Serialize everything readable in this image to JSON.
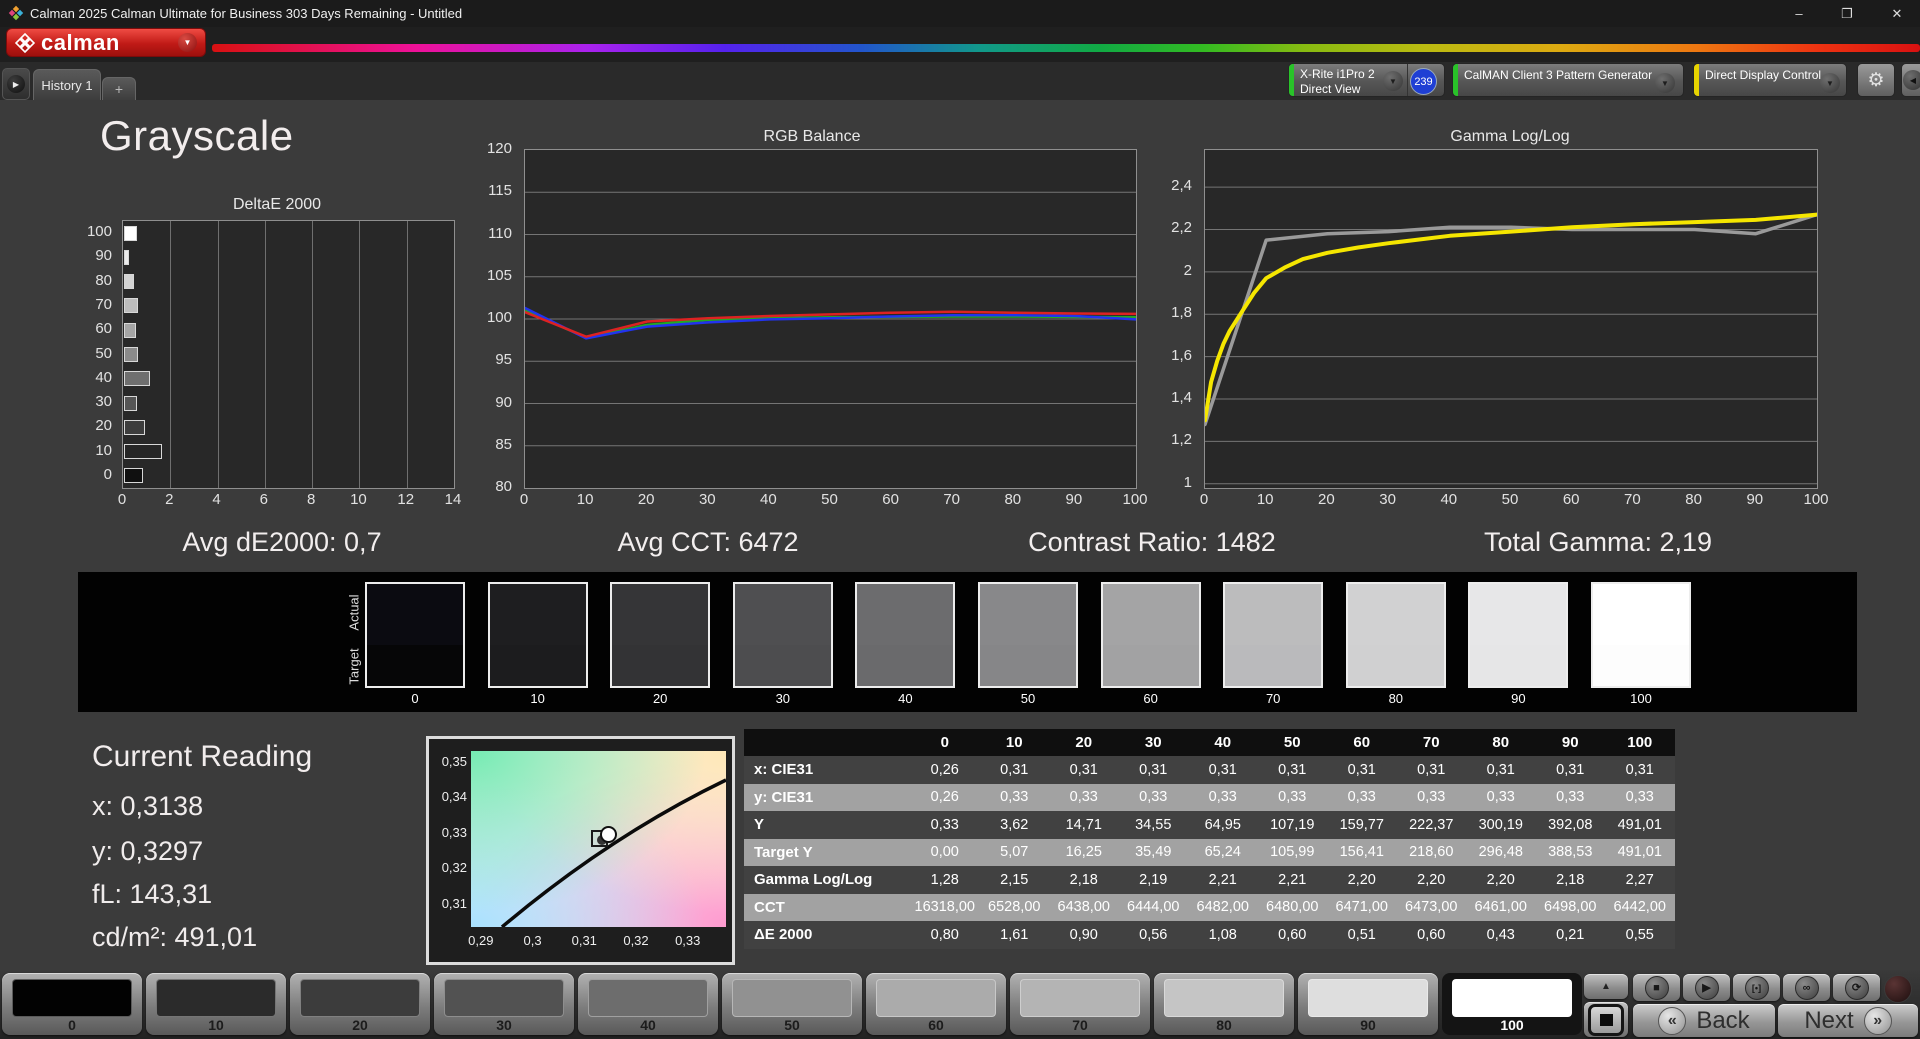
{
  "window": {
    "title": "Calman 2025 Calman Ultimate for Business 303 Days Remaining  - Untitled",
    "controls": {
      "minimize": "–",
      "restore": "❐",
      "close": "✕"
    }
  },
  "brand": {
    "logo_text": "calman"
  },
  "icons": {
    "chevron_down": "▼",
    "chevron_left": "◀",
    "play_small": "▶",
    "up_arrow": "▲",
    "back_chevron": "«",
    "next_chevron": "»"
  },
  "tabs": {
    "history_tab": "History 1",
    "add_tab": "+"
  },
  "toolbar": {
    "meter": {
      "line1": "X-Rite i1Pro 2",
      "line2": "Direct View",
      "badge": "239",
      "status_color": "#29c329",
      "badge_color": "#1f3fd4"
    },
    "pattern_generator": {
      "label": "CalMAN Client 3 Pattern Generator",
      "status_color": "#29c329"
    },
    "display_control": {
      "label": "Direct Display Control",
      "status_color": "#e8d400"
    }
  },
  "page": {
    "title": "Grayscale"
  },
  "stats": [
    "Avg dE2000: 0,7",
    "Avg CCT: 6472",
    "Contrast Ratio: 1482",
    "Total Gamma: 2,19"
  ],
  "chart_data": [
    {
      "type": "bar",
      "title": "DeltaE 2000",
      "orientation": "horizontal",
      "categories": [
        "100",
        "90",
        "80",
        "70",
        "60",
        "50",
        "40",
        "30",
        "20",
        "10",
        "0"
      ],
      "values": [
        0.55,
        0.21,
        0.43,
        0.6,
        0.51,
        0.6,
        1.08,
        0.56,
        0.9,
        1.61,
        0.8
      ],
      "bar_colors": [
        "#ffffff",
        "#ececec",
        "#d4d4d4",
        "#bdbdbd",
        "#a5a5a5",
        "#8b8b8b",
        "#6f6f6f",
        "#555555",
        "#3d3d3d",
        "#262626",
        "#101010"
      ],
      "xlim": [
        0,
        14
      ],
      "x_ticks": [
        {
          "label": "0",
          "value": 0
        },
        {
          "label": "2",
          "value": 2
        },
        {
          "label": "4",
          "value": 4
        },
        {
          "label": "6",
          "value": 6
        },
        {
          "label": "8",
          "value": 8
        },
        {
          "label": "10",
          "value": 10
        },
        {
          "label": "12",
          "value": 12
        },
        {
          "label": "14",
          "value": 14
        }
      ],
      "grid": "vertical"
    },
    {
      "type": "line",
      "title": "RGB Balance",
      "x": [
        0,
        10,
        20,
        30,
        40,
        50,
        60,
        70,
        80,
        90,
        100
      ],
      "series": [
        {
          "name": "Green",
          "color": "#22aa22",
          "width": 2.5,
          "values": [
            101.0,
            97.8,
            99.3,
            99.9,
            100.1,
            100.2,
            100.25,
            100.3,
            100.3,
            100.25,
            100.2
          ]
        },
        {
          "name": "Blue",
          "color": "#2233ee",
          "width": 2.5,
          "values": [
            101.3,
            97.7,
            99.1,
            99.6,
            99.95,
            100.1,
            100.3,
            100.45,
            100.45,
            100.35,
            99.95
          ]
        },
        {
          "name": "Red",
          "color": "#dd2222",
          "width": 2.5,
          "values": [
            100.8,
            97.9,
            99.7,
            100.1,
            100.35,
            100.55,
            100.75,
            100.85,
            100.75,
            100.65,
            100.6
          ]
        }
      ],
      "xlim": [
        0,
        100
      ],
      "ylim": [
        80,
        120
      ],
      "y_ticks": [
        {
          "label": "120",
          "value": 120
        },
        {
          "label": "115",
          "value": 115
        },
        {
          "label": "110",
          "value": 110
        },
        {
          "label": "105",
          "value": 105
        },
        {
          "label": "100",
          "value": 100
        },
        {
          "label": "95",
          "value": 95
        },
        {
          "label": "90",
          "value": 90
        },
        {
          "label": "85",
          "value": 85
        },
        {
          "label": "80",
          "value": 80
        }
      ],
      "x_ticks": [
        {
          "label": "0",
          "value": 0
        },
        {
          "label": "10",
          "value": 10
        },
        {
          "label": "20",
          "value": 20
        },
        {
          "label": "30",
          "value": 30
        },
        {
          "label": "40",
          "value": 40
        },
        {
          "label": "50",
          "value": 50
        },
        {
          "label": "60",
          "value": 60
        },
        {
          "label": "70",
          "value": 70
        },
        {
          "label": "80",
          "value": 80
        },
        {
          "label": "90",
          "value": 90
        },
        {
          "label": "100",
          "value": 100
        }
      ],
      "grid": "horizontal"
    },
    {
      "type": "line",
      "title": "Gamma Log/Log",
      "x": [
        0,
        10,
        20,
        30,
        40,
        50,
        60,
        70,
        80,
        90,
        100
      ],
      "series": [
        {
          "name": "Measured",
          "color": "#9a9a9a",
          "width": 3.5,
          "values": [
            1.28,
            2.15,
            2.18,
            2.19,
            2.21,
            2.21,
            2.2,
            2.2,
            2.2,
            2.18,
            2.27
          ]
        },
        {
          "name": "Target",
          "color": "#f5e600",
          "width": 4,
          "x": [
            0,
            1,
            2,
            3,
            4,
            6,
            8,
            10,
            13,
            16,
            20,
            25,
            30,
            40,
            50,
            60,
            70,
            80,
            90,
            100
          ],
          "values": [
            1.3,
            1.48,
            1.58,
            1.66,
            1.72,
            1.81,
            1.9,
            1.97,
            2.02,
            2.06,
            2.09,
            2.115,
            2.135,
            2.17,
            2.19,
            2.21,
            2.225,
            2.235,
            2.245,
            2.27
          ]
        }
      ],
      "xlim": [
        0,
        100
      ],
      "ylim": [
        0.98,
        2.575
      ],
      "y_ticks": [
        {
          "label": "2,4",
          "value": 2.4
        },
        {
          "label": "2,2",
          "value": 2.2
        },
        {
          "label": "2",
          "value": 2.0
        },
        {
          "label": "1,8",
          "value": 1.8
        },
        {
          "label": "1,6",
          "value": 1.6
        },
        {
          "label": "1,4",
          "value": 1.4
        },
        {
          "label": "1,2",
          "value": 1.2
        },
        {
          "label": "1",
          "value": 1.0
        }
      ],
      "x_ticks": [
        {
          "label": "0",
          "value": 0
        },
        {
          "label": "10",
          "value": 10
        },
        {
          "label": "20",
          "value": 20
        },
        {
          "label": "30",
          "value": 30
        },
        {
          "label": "40",
          "value": 40
        },
        {
          "label": "50",
          "value": 50
        },
        {
          "label": "60",
          "value": 60
        },
        {
          "label": "70",
          "value": 70
        },
        {
          "label": "80",
          "value": 80
        },
        {
          "label": "90",
          "value": 90
        },
        {
          "label": "100",
          "value": 100
        }
      ],
      "grid": "horizontal"
    },
    {
      "type": "scatter",
      "title": "CIE xy Current Reading",
      "xlim": [
        0.2881,
        0.3374
      ],
      "ylim": [
        0.3035,
        0.3531
      ],
      "x_ticks": [
        {
          "label": "0,29",
          "value": 0.29
        },
        {
          "label": "0,3",
          "value": 0.3
        },
        {
          "label": "0,31",
          "value": 0.31
        },
        {
          "label": "0,32",
          "value": 0.32
        },
        {
          "label": "0,33",
          "value": 0.33
        }
      ],
      "y_ticks": [
        {
          "label": "0,35",
          "value": 0.35
        },
        {
          "label": "0,34",
          "value": 0.34
        },
        {
          "label": "0,33",
          "value": 0.33
        },
        {
          "label": "0,32",
          "value": 0.32
        },
        {
          "label": "0,31",
          "value": 0.31
        }
      ],
      "point": {
        "x": 0.3138,
        "y": 0.3297
      }
    }
  ],
  "swatch_strip": {
    "row_labels": [
      "Actual",
      "Target"
    ],
    "levels": [
      {
        "label": "0",
        "actual": "#0b0b11",
        "target": "#060607"
      },
      {
        "label": "10",
        "actual": "#1e1e20",
        "target": "#1c1c1e"
      },
      {
        "label": "20",
        "actual": "#353537",
        "target": "#333335"
      },
      {
        "label": "30",
        "actual": "#4f4f51",
        "target": "#4d4d4f"
      },
      {
        "label": "40",
        "actual": "#6c6c6e",
        "target": "#6a6a6c"
      },
      {
        "label": "50",
        "actual": "#88888a",
        "target": "#868688"
      },
      {
        "label": "60",
        "actual": "#a4a4a5",
        "target": "#a2a2a3"
      },
      {
        "label": "70",
        "actual": "#bcbcbd",
        "target": "#bababc"
      },
      {
        "label": "80",
        "actual": "#d1d1d2",
        "target": "#d0d0d1"
      },
      {
        "label": "90",
        "actual": "#e7e7e8",
        "target": "#e6e6e7"
      },
      {
        "label": "100",
        "actual": "#ffffff",
        "target": "#fdfdfd"
      }
    ]
  },
  "current_reading": {
    "title": "Current Reading",
    "lines": [
      "x: 0,3138",
      "y: 0,3297",
      "fL: 143,31",
      "cd/m²: 491,01"
    ]
  },
  "table": {
    "columns": [
      "0",
      "10",
      "20",
      "30",
      "40",
      "50",
      "60",
      "70",
      "80",
      "90",
      "100"
    ],
    "rows": [
      {
        "label": "x: CIE31",
        "values": [
          "0,26",
          "0,31",
          "0,31",
          "0,31",
          "0,31",
          "0,31",
          "0,31",
          "0,31",
          "0,31",
          "0,31",
          "0,31"
        ]
      },
      {
        "label": "y: CIE31",
        "values": [
          "0,26",
          "0,33",
          "0,33",
          "0,33",
          "0,33",
          "0,33",
          "0,33",
          "0,33",
          "0,33",
          "0,33",
          "0,33"
        ]
      },
      {
        "label": "Y",
        "values": [
          "0,33",
          "3,62",
          "14,71",
          "34,55",
          "64,95",
          "107,19",
          "159,77",
          "222,37",
          "300,19",
          "392,08",
          "491,01"
        ]
      },
      {
        "label": "Target Y",
        "values": [
          "0,00",
          "5,07",
          "16,25",
          "35,49",
          "65,24",
          "105,99",
          "156,41",
          "218,60",
          "296,48",
          "388,53",
          "491,01"
        ]
      },
      {
        "label": "Gamma Log/Log",
        "values": [
          "1,28",
          "2,15",
          "2,18",
          "2,19",
          "2,21",
          "2,21",
          "2,20",
          "2,20",
          "2,20",
          "2,18",
          "2,27"
        ]
      },
      {
        "label": "CCT",
        "values": [
          "16318,00",
          "6528,00",
          "6438,00",
          "6444,00",
          "6482,00",
          "6480,00",
          "6471,00",
          "6473,00",
          "6461,00",
          "6498,00",
          "6442,00"
        ]
      },
      {
        "label": "ΔE 2000",
        "values": [
          "0,80",
          "1,61",
          "0,90",
          "0,56",
          "1,08",
          "0,60",
          "0,51",
          "0,60",
          "0,43",
          "0,21",
          "0,55"
        ]
      }
    ]
  },
  "bottom_bar": {
    "levels": [
      {
        "label": "0",
        "color": "#020202"
      },
      {
        "label": "10",
        "color": "#2b2b2b"
      },
      {
        "label": "20",
        "color": "#3c3c3c"
      },
      {
        "label": "30",
        "color": "#525252"
      },
      {
        "label": "40",
        "color": "#6d6d6d"
      },
      {
        "label": "50",
        "color": "#919191"
      },
      {
        "label": "60",
        "color": "#ababab"
      },
      {
        "label": "70",
        "color": "#b4b4b4"
      },
      {
        "label": "80",
        "color": "#c5c5c5"
      },
      {
        "label": "90",
        "color": "#dedede"
      },
      {
        "label": "100",
        "color": "#ffffff",
        "selected": true
      }
    ],
    "transport": [
      {
        "name": "stop-button",
        "glyph": "■"
      },
      {
        "name": "play-button",
        "glyph": "▶"
      },
      {
        "name": "single-measure-button",
        "glyph": "[•]"
      },
      {
        "name": "continuous-measure-button",
        "glyph": "∞"
      },
      {
        "name": "refresh-button",
        "glyph": "⟳"
      }
    ],
    "back_label": "Back",
    "next_label": "Next"
  }
}
